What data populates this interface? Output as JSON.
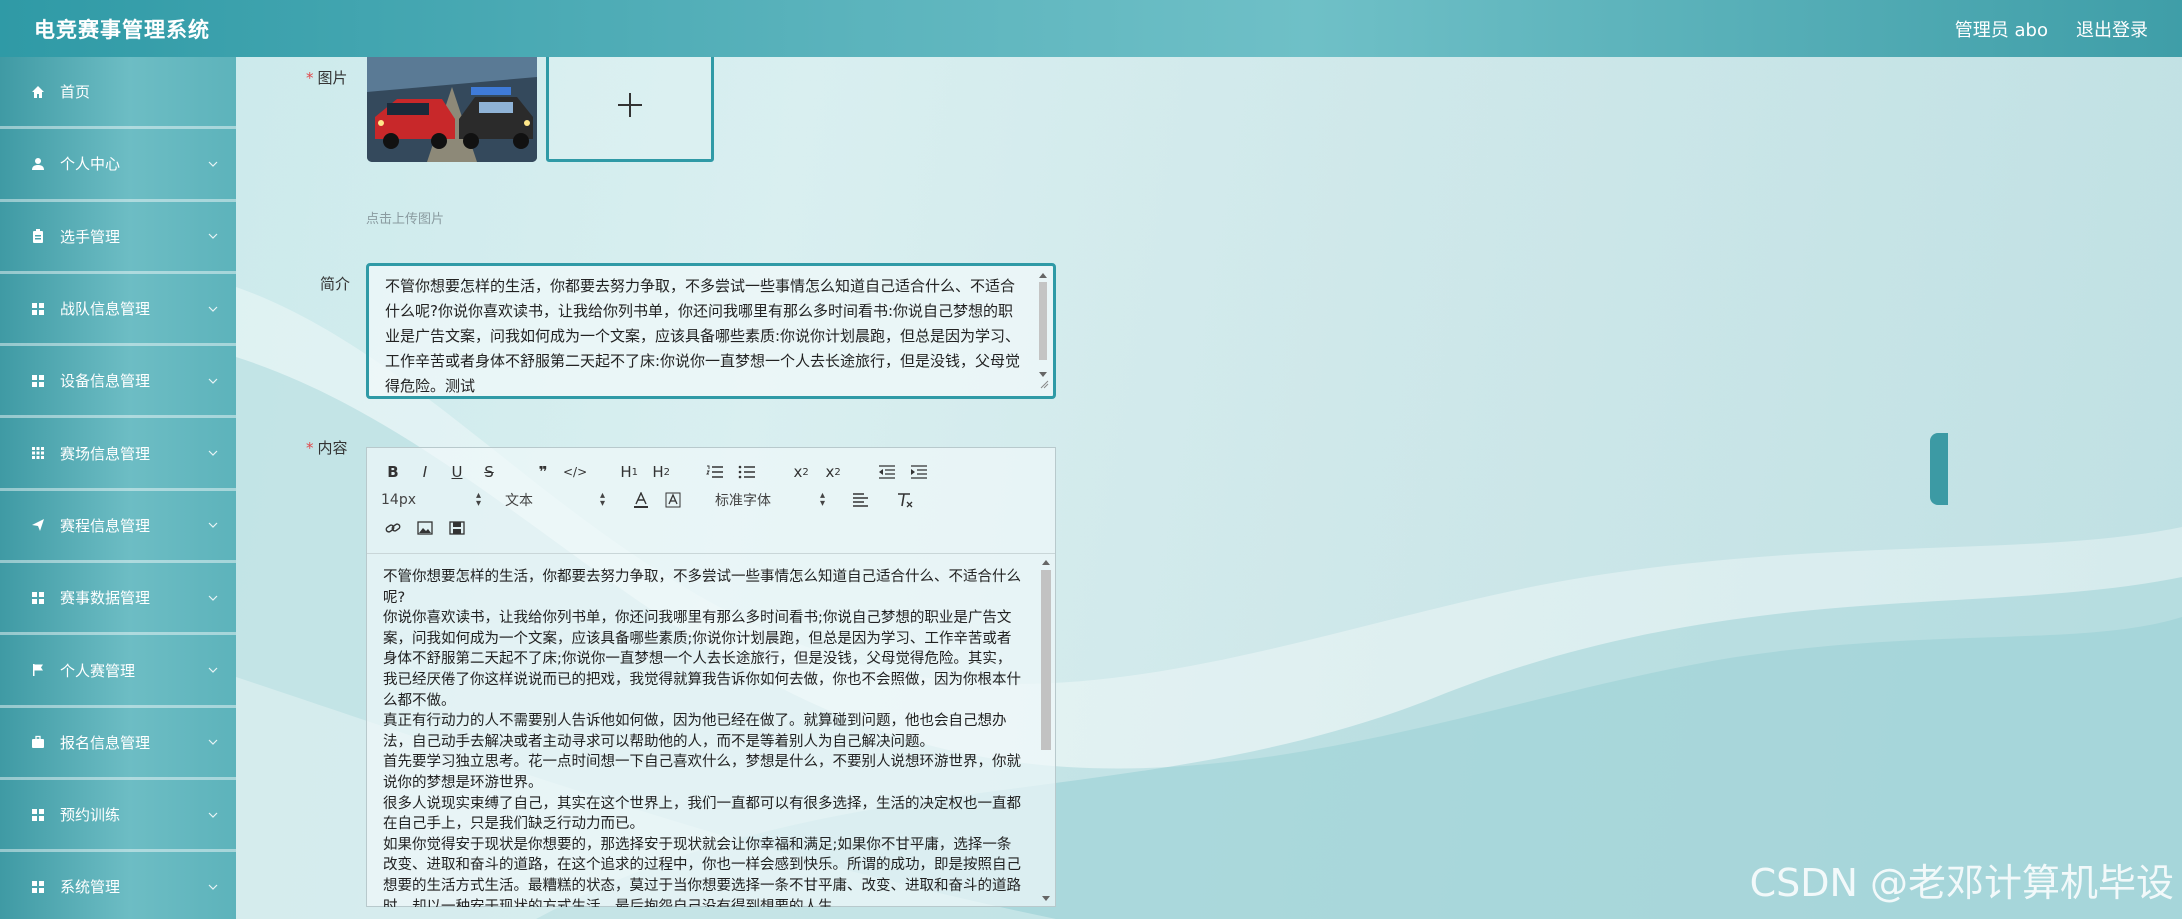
{
  "header": {
    "app_title": "电竞赛事管理系统",
    "user": "管理员 abo",
    "logout": "退出登录"
  },
  "sidebar": {
    "items": [
      {
        "label": "首页",
        "icon": "home-icon"
      },
      {
        "label": "个人中心",
        "icon": "user-icon"
      },
      {
        "label": "选手管理",
        "icon": "clipboard-icon"
      },
      {
        "label": "战队信息管理",
        "icon": "grid-icon"
      },
      {
        "label": "设备信息管理",
        "icon": "grid-icon"
      },
      {
        "label": "赛场信息管理",
        "icon": "grid-icon"
      },
      {
        "label": "赛程信息管理",
        "icon": "send-icon"
      },
      {
        "label": "赛事数据管理",
        "icon": "grid-icon"
      },
      {
        "label": "个人赛管理",
        "icon": "flag-icon"
      },
      {
        "label": "报名信息管理",
        "icon": "briefcase-icon"
      },
      {
        "label": "预约训练",
        "icon": "grid-icon"
      },
      {
        "label": "系统管理",
        "icon": "grid-icon"
      }
    ]
  },
  "form": {
    "image_label": "图片",
    "upload_hint": "点击上传图片",
    "intro_label": "简介",
    "intro_text": "不管你想要怎样的生活，你都要去努力争取，不多尝试一些事情怎么知道自己适合什么、不适合什么呢?你说你喜欢读书，让我给你列书单，你还问我哪里有那么多时间看书:你说自己梦想的职业是广告文案，问我如何成为一个文案，应该具备哪些素质:你说你计划晨跑，但总是因为学习、工作辛苦或者身体不舒服第二天起不了床:你说你一直梦想一个人去长途旅行，但是没钱，父母觉得危险。测试",
    "content_label": "内容",
    "toolbar": {
      "font_size": "14px",
      "text_type": "文本",
      "font_family": "标准字体"
    },
    "content_paragraphs": [
      "不管你想要怎样的生活，你都要去努力争取，不多尝试一些事情怎么知道自己适合什么、不适合什么呢?",
      "你说你喜欢读书，让我给你列书单，你还问我哪里有那么多时间看书;你说自己梦想的职业是广告文案，问我如何成为一个文案，应该具备哪些素质;你说你计划晨跑，但总是因为学习、工作辛苦或者身体不舒服第二天起不了床;你说你一直梦想一个人去长途旅行，但是没钱，父母觉得危险。其实，我已经厌倦了你这样说说而已的把戏，我觉得就算我告诉你如何去做，你也不会照做，因为你根本什么都不做。",
      "真正有行动力的人不需要别人告诉他如何做，因为他已经在做了。就算碰到问题，他也会自己想办法，自己动手去解决或者主动寻求可以帮助他的人，而不是等着别人为自己解决问题。",
      "首先要学习独立思考。花一点时间想一下自己喜欢什么，梦想是什么，不要别人说想环游世界，你就说你的梦想是环游世界。",
      "很多人说现实束缚了自己，其实在这个世界上，我们一直都可以有很多选择，生活的决定权也一直都在自己手上，只是我们缺乏行动力而已。",
      "如果你觉得安于现状是你想要的，那选择安于现状就会让你幸福和满足;如果你不甘平庸，选择一条改变、进取和奋斗的道路，在这个追求的过程中，你也一样会感到快乐。所谓的成功，即是按照自己想要的生活方式生活。最糟糕的状态，莫过于当你想要选择一条不甘平庸、改变、进取和奋斗的道路时，却以一种安于现状的方式生活，最后抱怨自己没有得到想要的人生。"
    ]
  },
  "watermark": "CSDN @老邓计算机毕设"
}
